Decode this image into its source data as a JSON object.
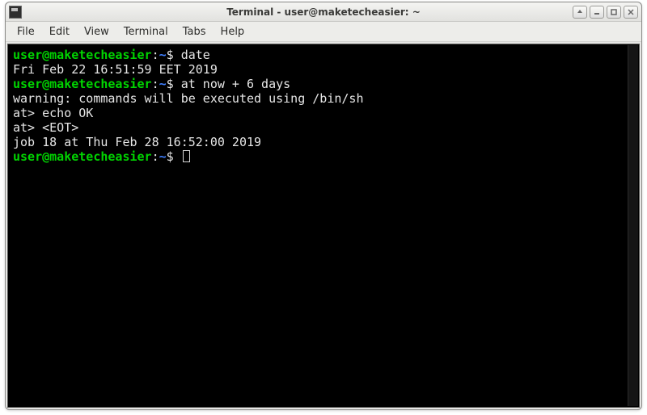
{
  "window": {
    "title": "Terminal - user@maketecheasier: ~"
  },
  "menubar": {
    "items": [
      "File",
      "Edit",
      "View",
      "Terminal",
      "Tabs",
      "Help"
    ]
  },
  "prompt": {
    "user_host": "user@maketecheasier",
    "sep": ":",
    "cwd": "~",
    "symbol": "$"
  },
  "lines": {
    "cmd1": "date",
    "out1": "Fri Feb 22 16:51:59 EET 2019",
    "cmd2": "at now + 6 days",
    "out2": "warning: commands will be executed using /bin/sh",
    "out3": "at> echo OK",
    "out4": "at> <EOT>",
    "out5": "job 18 at Thu Feb 28 16:52:00 2019"
  }
}
